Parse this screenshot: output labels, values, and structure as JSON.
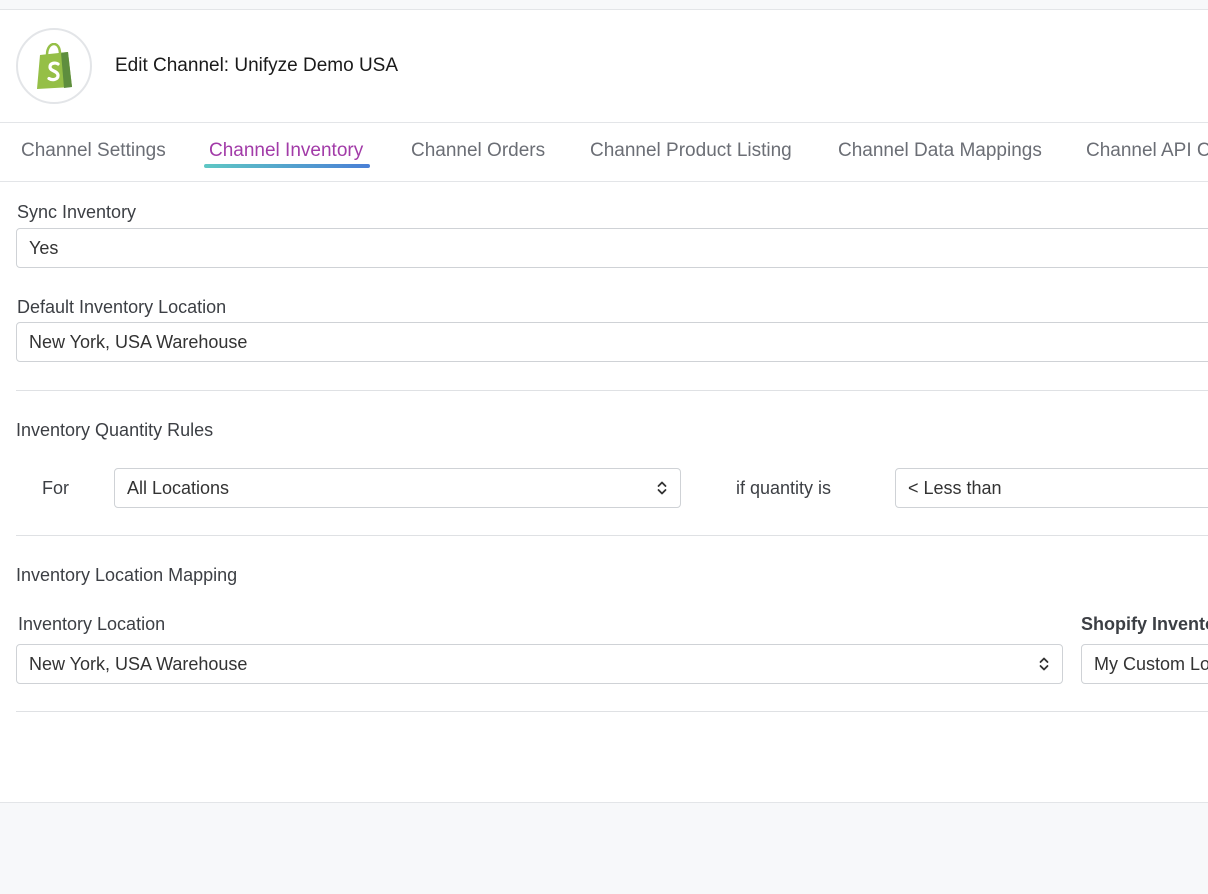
{
  "header": {
    "title": "Edit Channel: Unifyze Demo USA",
    "logo_icon": "shopify-bag-icon",
    "logo_color": "#95bf47"
  },
  "tabs": [
    {
      "label": "Channel Settings",
      "active": false
    },
    {
      "label": "Channel Inventory",
      "active": true
    },
    {
      "label": "Channel Orders",
      "active": false
    },
    {
      "label": "Channel Product Listing",
      "active": false
    },
    {
      "label": "Channel Data Mappings",
      "active": false
    },
    {
      "label": "Channel API Cr",
      "active": false
    }
  ],
  "sync_inventory": {
    "label": "Sync Inventory",
    "value": "Yes"
  },
  "default_location": {
    "label": "Default Inventory Location",
    "value": "New York, USA Warehouse"
  },
  "quantity_rules": {
    "title": "Inventory Quantity Rules",
    "for_label": "For",
    "location_value": "All Locations",
    "condition_label": "if quantity is",
    "condition_value": "< Less than"
  },
  "location_mapping": {
    "title": "Inventory Location Mapping",
    "inventory_location_label": "Inventory Location",
    "inventory_location_value": "New York, USA Warehouse",
    "shopify_location_label": "Shopify Invento",
    "shopify_location_value": "My Custom Lo"
  },
  "colors": {
    "accent": "#a23ba8",
    "tab_underline_start": "#5ec7c4",
    "tab_underline_end": "#4a7fd6"
  }
}
